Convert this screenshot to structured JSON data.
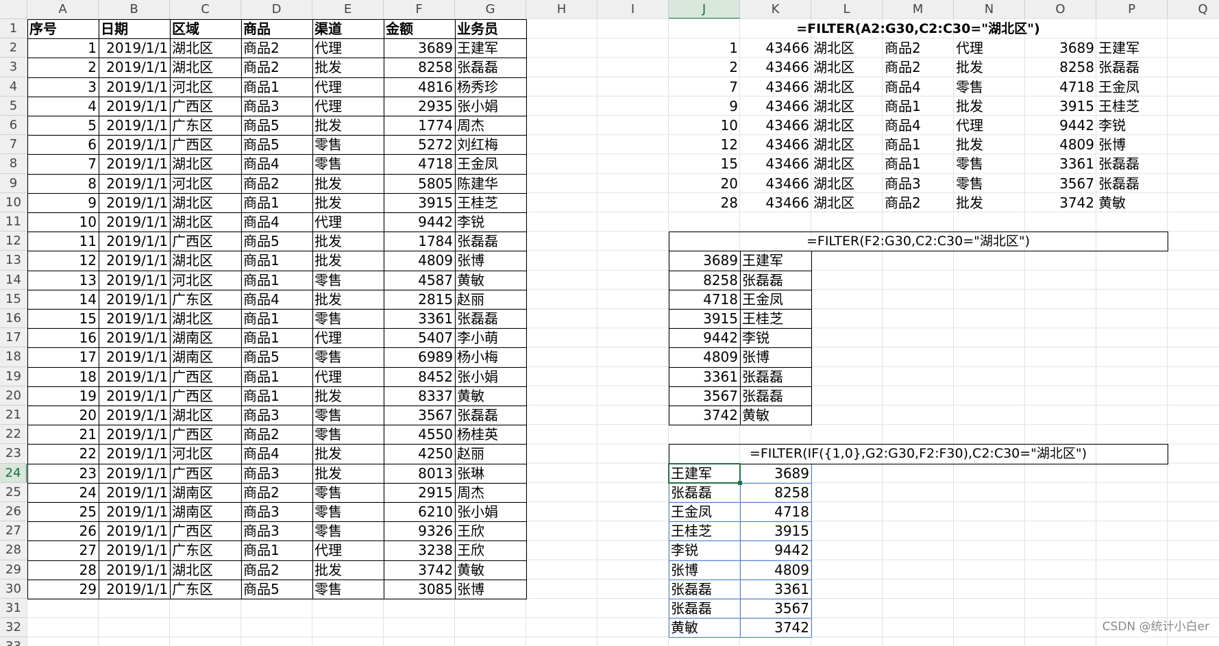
{
  "columns": [
    "A",
    "B",
    "C",
    "D",
    "E",
    "F",
    "G",
    "H",
    "I",
    "J",
    "K",
    "L",
    "M",
    "N",
    "O",
    "P",
    "Q"
  ],
  "rows": [
    "1",
    "2",
    "3",
    "4",
    "5",
    "6",
    "7",
    "8",
    "9",
    "10",
    "11",
    "12",
    "13",
    "14",
    "15",
    "16",
    "17",
    "18",
    "19",
    "20",
    "21",
    "22",
    "23",
    "24",
    "25",
    "26",
    "27",
    "28",
    "29",
    "30",
    "31",
    "32",
    "33"
  ],
  "active": {
    "column": "J",
    "row": "24"
  },
  "main_table": {
    "headers": [
      "序号",
      "日期",
      "区域",
      "商品",
      "渠道",
      "金额",
      "业务员"
    ],
    "rows": [
      [
        "1",
        "2019/1/1",
        "湖北区",
        "商品2",
        "代理",
        "3689",
        "王建军"
      ],
      [
        "2",
        "2019/1/1",
        "湖北区",
        "商品2",
        "批发",
        "8258",
        "张磊磊"
      ],
      [
        "3",
        "2019/1/1",
        "河北区",
        "商品1",
        "代理",
        "4816",
        "杨秀珍"
      ],
      [
        "4",
        "2019/1/1",
        "广西区",
        "商品3",
        "代理",
        "2935",
        "张小娟"
      ],
      [
        "5",
        "2019/1/1",
        "广东区",
        "商品5",
        "批发",
        "1774",
        "周杰"
      ],
      [
        "6",
        "2019/1/1",
        "广西区",
        "商品5",
        "零售",
        "5272",
        "刘红梅"
      ],
      [
        "7",
        "2019/1/1",
        "湖北区",
        "商品4",
        "零售",
        "4718",
        "王金凤"
      ],
      [
        "8",
        "2019/1/1",
        "河北区",
        "商品2",
        "批发",
        "5805",
        "陈建华"
      ],
      [
        "9",
        "2019/1/1",
        "湖北区",
        "商品1",
        "批发",
        "3915",
        "王桂芝"
      ],
      [
        "10",
        "2019/1/1",
        "湖北区",
        "商品4",
        "代理",
        "9442",
        "李锐"
      ],
      [
        "11",
        "2019/1/1",
        "广西区",
        "商品5",
        "批发",
        "1784",
        "张磊磊"
      ],
      [
        "12",
        "2019/1/1",
        "湖北区",
        "商品1",
        "批发",
        "4809",
        "张博"
      ],
      [
        "13",
        "2019/1/1",
        "河北区",
        "商品1",
        "零售",
        "4587",
        "黄敏"
      ],
      [
        "14",
        "2019/1/1",
        "广东区",
        "商品4",
        "批发",
        "2815",
        "赵丽"
      ],
      [
        "15",
        "2019/1/1",
        "湖北区",
        "商品1",
        "零售",
        "3361",
        "张磊磊"
      ],
      [
        "16",
        "2019/1/1",
        "湖南区",
        "商品1",
        "代理",
        "5407",
        "李小萌"
      ],
      [
        "17",
        "2019/1/1",
        "湖南区",
        "商品5",
        "零售",
        "6989",
        "杨小梅"
      ],
      [
        "18",
        "2019/1/1",
        "广西区",
        "商品1",
        "代理",
        "8452",
        "张小娟"
      ],
      [
        "19",
        "2019/1/1",
        "广西区",
        "商品1",
        "批发",
        "8337",
        "黄敏"
      ],
      [
        "20",
        "2019/1/1",
        "湖北区",
        "商品3",
        "零售",
        "3567",
        "张磊磊"
      ],
      [
        "21",
        "2019/1/1",
        "广西区",
        "商品2",
        "零售",
        "4550",
        "杨桂英"
      ],
      [
        "22",
        "2019/1/1",
        "河北区",
        "商品4",
        "批发",
        "4250",
        "赵丽"
      ],
      [
        "23",
        "2019/1/1",
        "广西区",
        "商品3",
        "批发",
        "8013",
        "张琳"
      ],
      [
        "24",
        "2019/1/1",
        "湖南区",
        "商品2",
        "零售",
        "2915",
        "周杰"
      ],
      [
        "25",
        "2019/1/1",
        "湖南区",
        "商品3",
        "零售",
        "6210",
        "张小娟"
      ],
      [
        "26",
        "2019/1/1",
        "广西区",
        "商品3",
        "零售",
        "9326",
        "王欣"
      ],
      [
        "27",
        "2019/1/1",
        "广东区",
        "商品1",
        "代理",
        "3238",
        "王欣"
      ],
      [
        "28",
        "2019/1/1",
        "湖北区",
        "商品2",
        "批发",
        "3742",
        "黄敏"
      ],
      [
        "29",
        "2019/1/1",
        "广东区",
        "商品5",
        "零售",
        "3085",
        "张博"
      ]
    ]
  },
  "filter1": {
    "formula": "=FILTER(A2:G30,C2:C30=\"湖北区\")",
    "rows": [
      [
        "1",
        "43466",
        "湖北区",
        "商品2",
        "代理",
        "3689",
        "王建军"
      ],
      [
        "2",
        "43466",
        "湖北区",
        "商品2",
        "批发",
        "8258",
        "张磊磊"
      ],
      [
        "7",
        "43466",
        "湖北区",
        "商品4",
        "零售",
        "4718",
        "王金凤"
      ],
      [
        "9",
        "43466",
        "湖北区",
        "商品1",
        "批发",
        "3915",
        "王桂芝"
      ],
      [
        "10",
        "43466",
        "湖北区",
        "商品4",
        "代理",
        "9442",
        "李锐"
      ],
      [
        "12",
        "43466",
        "湖北区",
        "商品1",
        "批发",
        "4809",
        "张博"
      ],
      [
        "15",
        "43466",
        "湖北区",
        "商品1",
        "零售",
        "3361",
        "张磊磊"
      ],
      [
        "20",
        "43466",
        "湖北区",
        "商品3",
        "零售",
        "3567",
        "张磊磊"
      ],
      [
        "28",
        "43466",
        "湖北区",
        "商品2",
        "批发",
        "3742",
        "黄敏"
      ]
    ]
  },
  "filter2": {
    "formula": "=FILTER(F2:G30,C2:C30=\"湖北区\")",
    "rows": [
      [
        "3689",
        "王建军"
      ],
      [
        "8258",
        "张磊磊"
      ],
      [
        "4718",
        "王金凤"
      ],
      [
        "3915",
        "王桂芝"
      ],
      [
        "9442",
        "李锐"
      ],
      [
        "4809",
        "张博"
      ],
      [
        "3361",
        "张磊磊"
      ],
      [
        "3567",
        "张磊磊"
      ],
      [
        "3742",
        "黄敏"
      ]
    ]
  },
  "filter3": {
    "formula": "=FILTER(IF({1,0},G2:G30,F2:F30),C2:C30=\"湖北区\")",
    "rows": [
      [
        "王建军",
        "3689"
      ],
      [
        "张磊磊",
        "8258"
      ],
      [
        "王金凤",
        "4718"
      ],
      [
        "王桂芝",
        "3915"
      ],
      [
        "李锐",
        "9442"
      ],
      [
        "张博",
        "4809"
      ],
      [
        "张磊磊",
        "3361"
      ],
      [
        "张磊磊",
        "3567"
      ],
      [
        "黄敏",
        "3742"
      ]
    ]
  },
  "watermark": "CSDN @统计小白er"
}
